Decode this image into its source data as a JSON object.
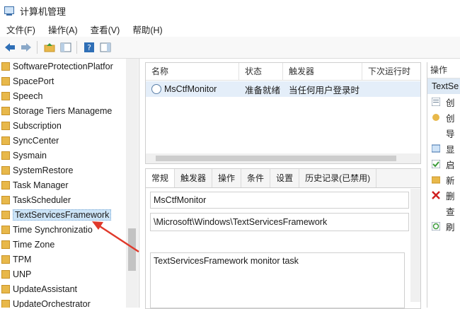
{
  "window": {
    "title": "计算机管理"
  },
  "menu": [
    "文件(F)",
    "操作(A)",
    "查看(V)",
    "帮助(H)"
  ],
  "tree": {
    "items": [
      "SoftwareProtectionPlatfor",
      "SpacePort",
      "Speech",
      "Storage Tiers Manageme",
      "Subscription",
      "SyncCenter",
      "Sysmain",
      "SystemRestore",
      "Task Manager",
      "TaskScheduler",
      "TextServicesFramework",
      "Time Synchronizatio",
      "Time Zone",
      "TPM",
      "UNP",
      "UpdateAssistant",
      "UpdateOrchestrator"
    ],
    "selected": "TextServicesFramework"
  },
  "task_list": {
    "headers": [
      "名称",
      "状态",
      "触发器",
      "下次运行时"
    ],
    "rows": [
      {
        "name": "MsCtfMonitor",
        "status": "准备就绪",
        "trigger": "当任何用户登录时"
      }
    ]
  },
  "detail": {
    "tabs": [
      "常规",
      "触发器",
      "操作",
      "条件",
      "设置",
      "历史记录(已禁用)"
    ],
    "active_tab": "常规",
    "name": "MsCtfMonitor",
    "location": "\\Microsoft\\Windows\\TextServicesFramework",
    "description": "TextServicesFramework monitor task"
  },
  "actions": {
    "header": "操作",
    "selected": "TextSe",
    "items": [
      "创",
      "创",
      "导",
      "显",
      "启",
      "新",
      "删",
      "查",
      "刷"
    ]
  },
  "colors": {
    "accent": "#2f6fb6",
    "selection": "#cce4f7",
    "arrow": "#e0392b"
  }
}
